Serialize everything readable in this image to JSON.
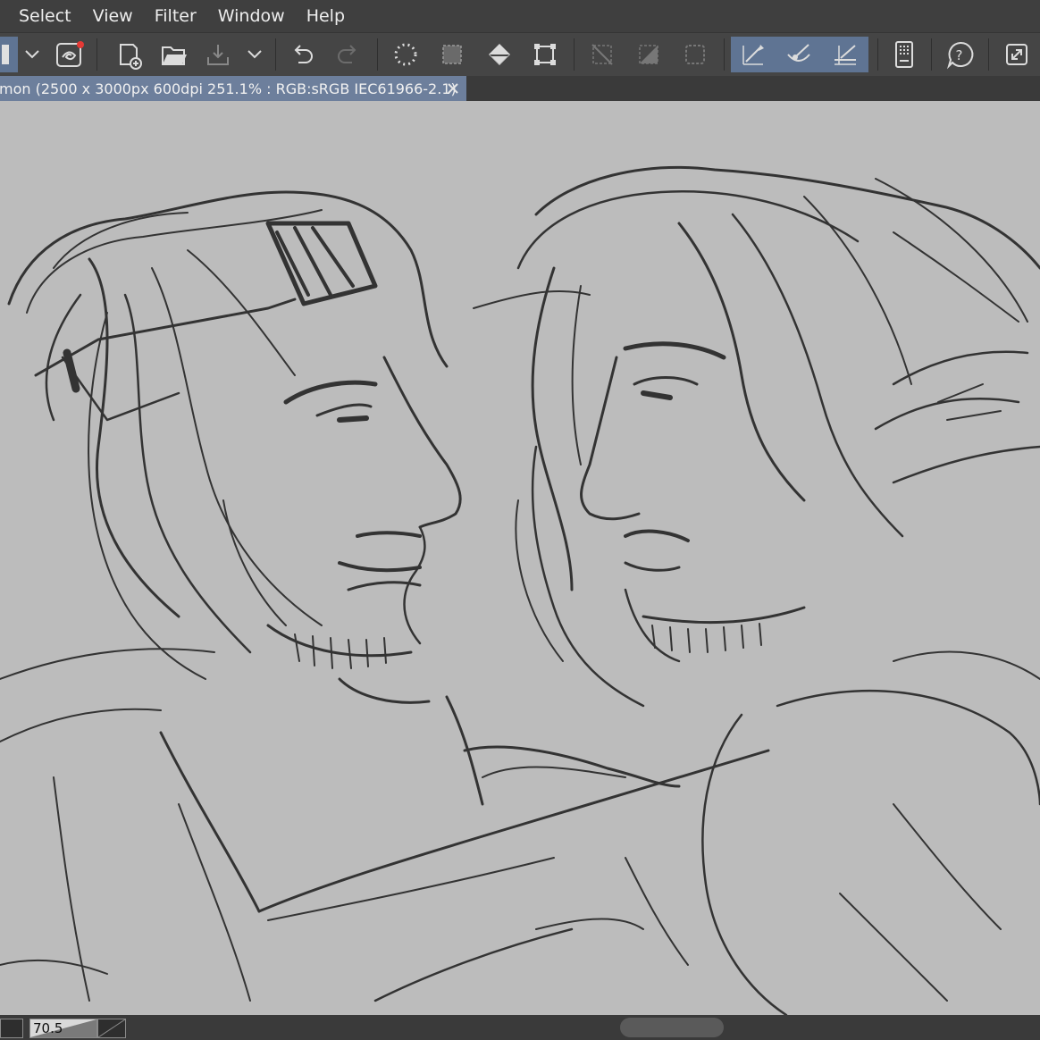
{
  "menu": [
    "Select",
    "View",
    "Filter",
    "Window",
    "Help"
  ],
  "toolbar": {
    "icons": [
      "layer-icon",
      "chevron-down-icon",
      "swirl-icon",
      "new-file-icon",
      "open-folder-icon",
      "save-icon",
      "chevron-down-icon",
      "undo-icon",
      "redo-icon",
      "lasso-icon",
      "select-all-icon",
      "fill-icon",
      "transform-icon",
      "deselect-icon",
      "invert-selection-icon",
      "selection-border-icon",
      "pen-pressure-icon",
      "brush-icon",
      "ruler-snap-icon",
      "tablet-icon",
      "help-icon",
      "fullscreen-icon"
    ],
    "active_icons": [
      "pen-pressure-icon",
      "brush-icon",
      "ruler-snap-icon"
    ]
  },
  "document_tab": {
    "title": "mon (2500 x 3000px 600dpi 251.1% : RGB:sRGB IEC61966-2.1)",
    "close_icon": "close-icon"
  },
  "canvas": {
    "background": "#bcbcbc",
    "stroke_color": "#1a1a1a"
  },
  "statusbar": {
    "zoom_value": "70.5"
  },
  "colors": {
    "accent_selected": "#5f7493",
    "tab_active": "#6d7f9c",
    "menubar": "#3f3f3f",
    "toolbar": "#454545"
  }
}
